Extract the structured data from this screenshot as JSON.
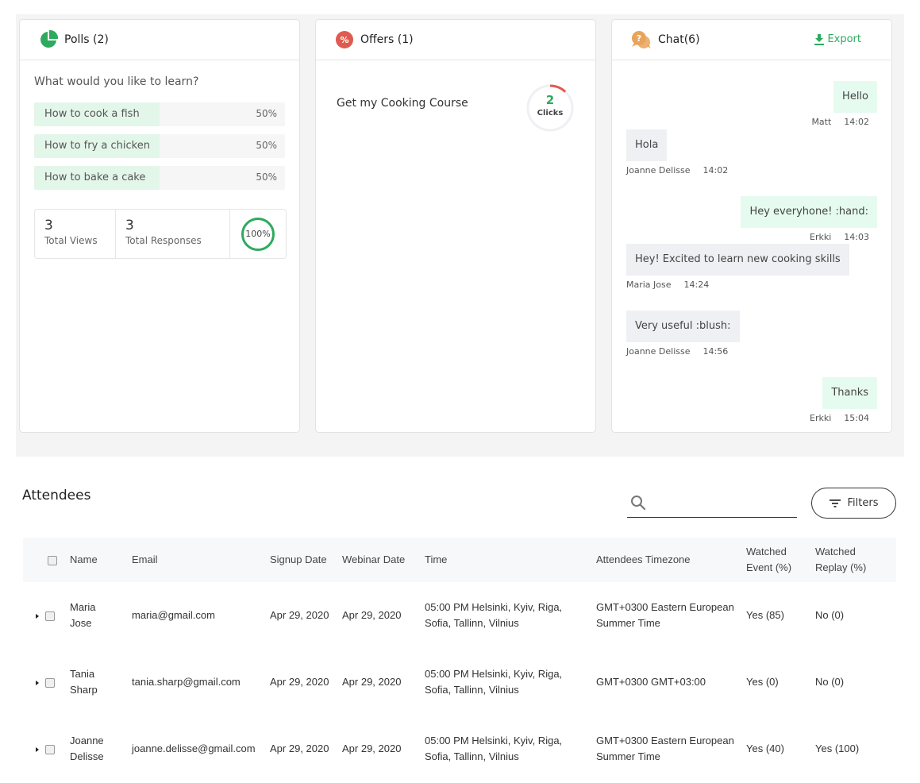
{
  "polls": {
    "title": "Polls (2)",
    "icon": "pie-chart-icon",
    "question": "What would you like to learn?",
    "options": [
      {
        "label": "How to cook a fish",
        "percent": "50%",
        "value": 50
      },
      {
        "label": "How to fry a chicken",
        "percent": "50%",
        "value": 50
      },
      {
        "label": "How to bake a cake",
        "percent": "50%",
        "value": 50
      }
    ],
    "stats": {
      "views_count": "3",
      "views_label": "Total Views",
      "responses_count": "3",
      "responses_label": "Total Responses",
      "response_rate": "100%",
      "response_rate_value": 100
    }
  },
  "offers": {
    "title": "Offers (1)",
    "icon": "percent-badge-icon",
    "items": [
      {
        "name": "Get my Cooking Course",
        "clicks": "2",
        "clicks_label": "Clicks",
        "ring_fraction": 0.12
      }
    ]
  },
  "chat": {
    "title": "Chat(6)",
    "icon": "chat-question-icon",
    "export_label": "Export",
    "messages": [
      {
        "side": "right",
        "text": "Hello",
        "author": "Matt",
        "time": "14:02"
      },
      {
        "side": "left",
        "text": "Hola",
        "author": "Joanne Delisse",
        "time": "14:02"
      },
      {
        "side": "right",
        "text": "Hey everyhone! :hand:",
        "author": "Erkki",
        "time": "14:03"
      },
      {
        "side": "left",
        "text": "Hey! Excited to learn new cooking skills",
        "author": "Maria Jose",
        "time": "14:24"
      },
      {
        "side": "left",
        "text": "Very useful :blush:",
        "author": "Joanne Delisse",
        "time": "14:56"
      },
      {
        "side": "right",
        "text": "Thanks",
        "author": "Erkki",
        "time": "15:04"
      }
    ]
  },
  "attendees": {
    "title": "Attendees",
    "search_placeholder": "",
    "filters_label": "Filters",
    "columns": [
      "Name",
      "Email",
      "Signup Date",
      "Webinar Date",
      "Time",
      "Attendees Timezone",
      "Watched Event (%)",
      "Watched Replay (%)"
    ],
    "column_lines": {
      "watched_event": [
        "Watched",
        "Event (%)"
      ],
      "watched_replay": [
        "Watched",
        "Replay (%)"
      ]
    },
    "rows": [
      {
        "first": "Maria",
        "last": "Jose",
        "email": "maria@gmail.com",
        "signup": "Apr 29, 2020",
        "webinar": "Apr 29, 2020",
        "time1": "05:00 PM Helsinki, Kyiv, Riga,",
        "time2": "Sofia, Tallinn, Vilnius",
        "tz1": "GMT+0300 Eastern European",
        "tz2": "Summer Time",
        "event": "Yes (85)",
        "replay": "No (0)"
      },
      {
        "first": "Tania",
        "last": "Sharp",
        "email": "tania.sharp@gmail.com",
        "signup": "Apr 29, 2020",
        "webinar": "Apr 29, 2020",
        "time1": "05:00 PM Helsinki, Kyiv, Riga,",
        "time2": "Sofia, Tallinn, Vilnius",
        "tz1": "GMT+0300 GMT+03:00",
        "tz2": "",
        "event": "Yes (0)",
        "replay": "No (0)"
      },
      {
        "first": "Joanne",
        "last": "Delisse",
        "email": "joanne.delisse@gmail.com",
        "signup": "Apr 29, 2020",
        "webinar": "Apr 29, 2020",
        "time1": "05:00 PM Helsinki, Kyiv, Riga,",
        "time2": "Sofia, Tallinn, Vilnius",
        "tz1": "GMT+0300 Eastern European",
        "tz2": "Summer Time",
        "event": "Yes (40)",
        "replay": "Yes (100)"
      }
    ]
  },
  "colors": {
    "accent_green": "#2daa5e",
    "poll_fill": "#e3f6ea",
    "offer_red": "#e05a4f",
    "chat_orange": "#e8a45a",
    "chat_bubble_right": "#e6fbef",
    "chat_bubble_left": "#eff0f3"
  }
}
